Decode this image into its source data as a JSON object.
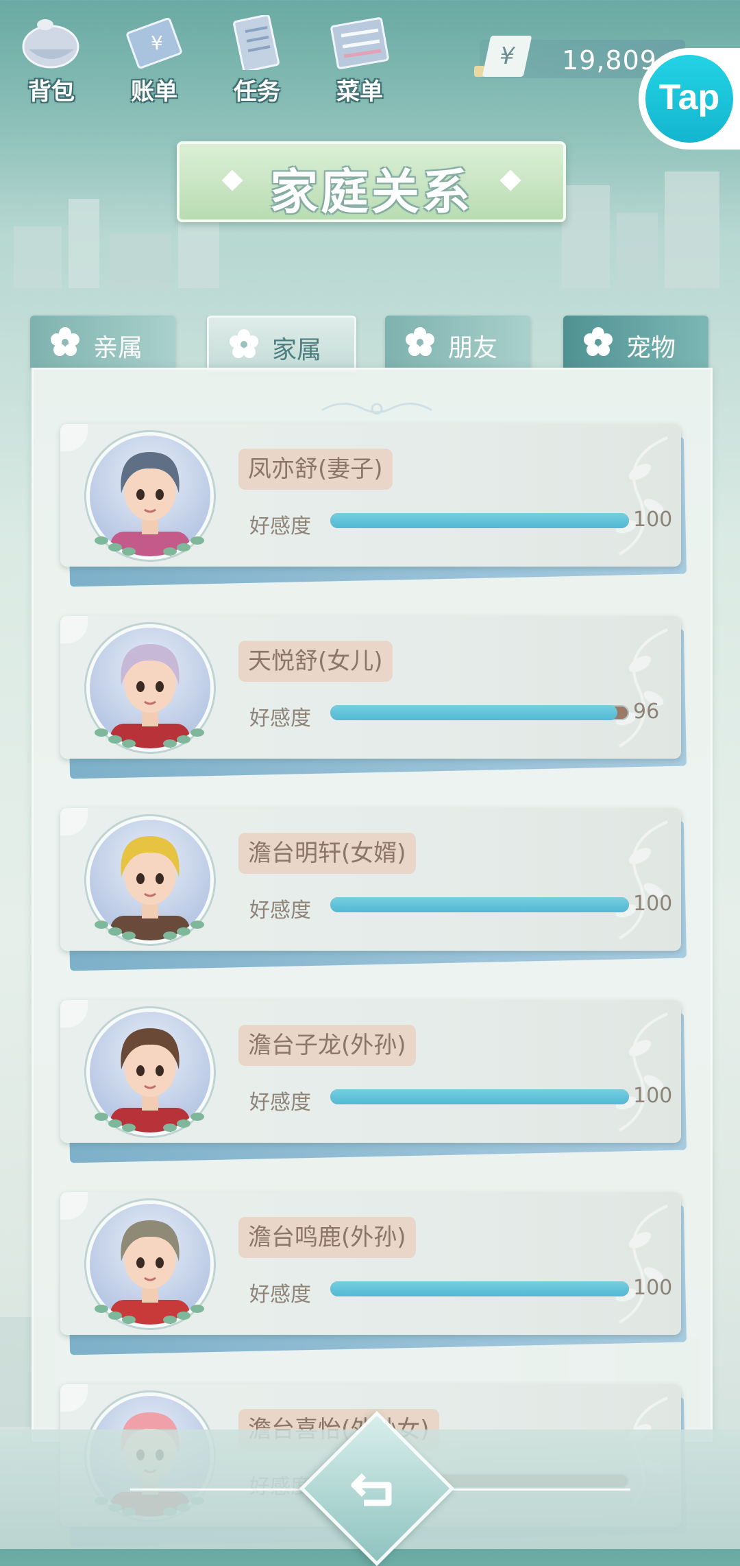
{
  "header": {
    "icons": [
      {
        "id": "bag",
        "label": "背包",
        "icon": "bag-icon"
      },
      {
        "id": "bill",
        "label": "账单",
        "icon": "bill-icon"
      },
      {
        "id": "task",
        "label": "任务",
        "icon": "task-icon"
      },
      {
        "id": "menu",
        "label": "菜单",
        "icon": "menu-icon"
      }
    ],
    "currency_symbol": "¥",
    "money": "19,809",
    "tap_label": "Tap"
  },
  "title": "家庭关系",
  "tabs": [
    {
      "label": "亲属",
      "active": false
    },
    {
      "label": "家属",
      "active": true
    },
    {
      "label": "朋友",
      "active": false
    },
    {
      "label": "宠物",
      "active": false
    }
  ],
  "affection_label": "好感度",
  "members": [
    {
      "name": "凤亦舒(妻子)",
      "affection": 100,
      "max": 100,
      "affection_text": "100"
    },
    {
      "name": "天悦舒(女儿)",
      "affection": 96,
      "max": 100,
      "affection_text": "96"
    },
    {
      "name": "澹台明轩(女婿)",
      "affection": 100,
      "max": 100,
      "affection_text": "100"
    },
    {
      "name": "澹台子龙(外孙)",
      "affection": 100,
      "max": 100,
      "affection_text": "100"
    },
    {
      "name": "澹台鸣鹿(外孙)",
      "affection": 100,
      "max": 100,
      "affection_text": "100"
    },
    {
      "name": "澹台喜怡(外孙女)",
      "affection": null,
      "max": 100,
      "affection_text": ""
    }
  ],
  "colors": {
    "bar_fill": "#5cc2d8",
    "bar_track": "#9a7a66",
    "name_tag": "#e9d6c8",
    "title_banner": "#c6e4be",
    "tap": "#17c0d8"
  }
}
